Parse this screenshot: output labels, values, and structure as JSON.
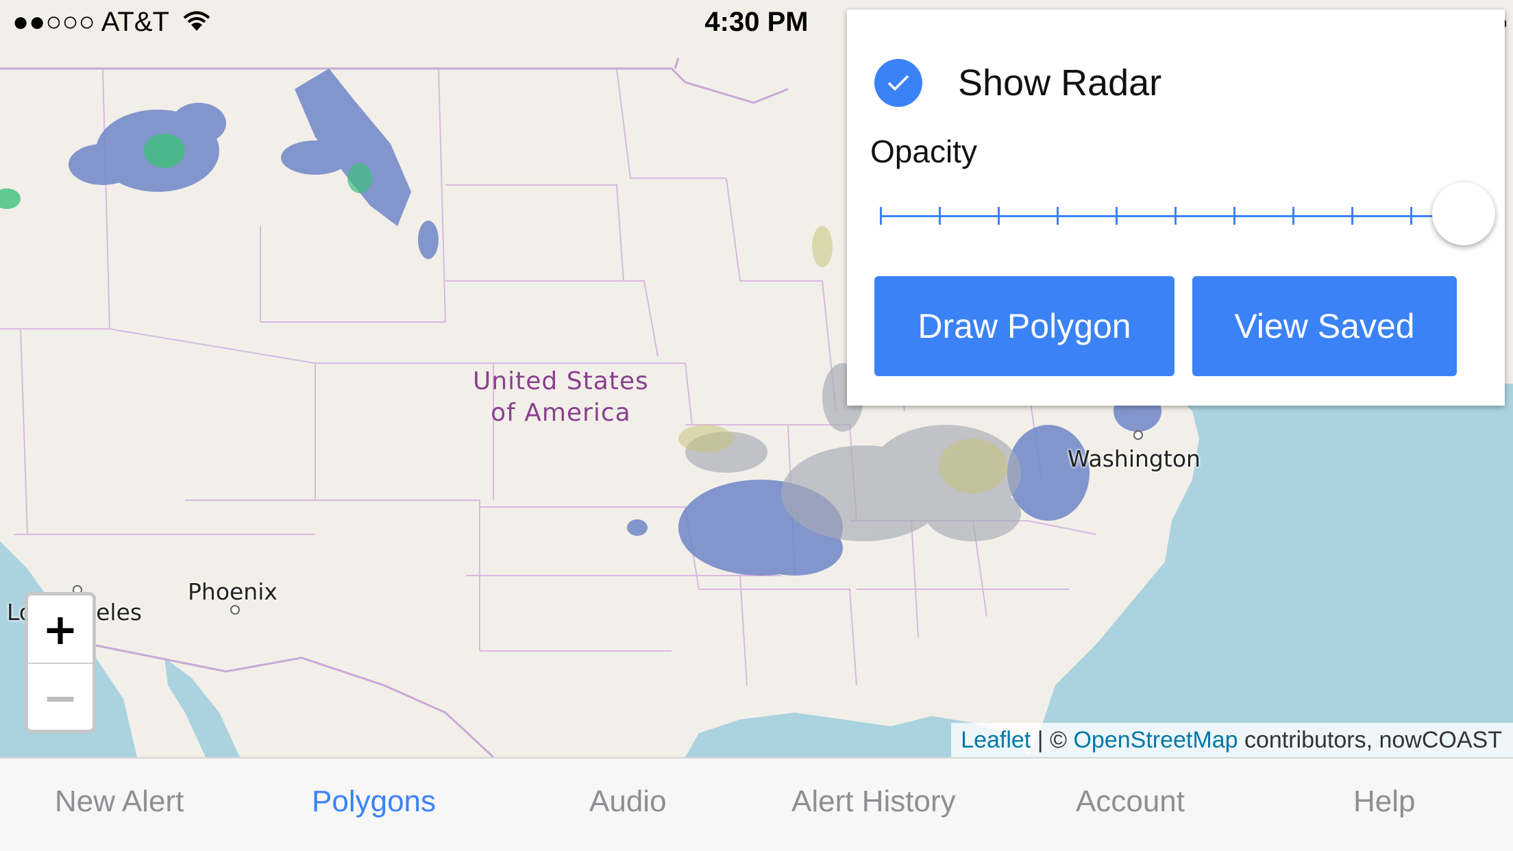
{
  "status_bar": {
    "carrier": "●●○○○ AT&T",
    "time": "4:30 PM"
  },
  "map": {
    "country_label_line1": "United States",
    "country_label_line2": "of America",
    "cities": {
      "washington": "Washington",
      "phoenix": "Phoenix",
      "los_angeles": "Los Angeles"
    },
    "zoom_in": "+",
    "zoom_out": "−",
    "attribution": {
      "leaflet": "Leaflet",
      "separator": " | © ",
      "osm": "OpenStreetMap",
      "rest": " contributors, nowCOAST"
    }
  },
  "radar_panel": {
    "show_radar_label": "Show Radar",
    "show_radar_checked": true,
    "opacity_label": "Opacity",
    "opacity_value": 1.0,
    "draw_polygon_label": "Draw Polygon",
    "view_saved_label": "View Saved"
  },
  "tabs": [
    {
      "label": "New Alert",
      "active": false
    },
    {
      "label": "Polygons",
      "active": true
    },
    {
      "label": "Audio",
      "active": false
    },
    {
      "label": "Alert History",
      "active": false
    },
    {
      "label": "Account",
      "active": false
    },
    {
      "label": "Help",
      "active": false
    }
  ],
  "colors": {
    "accent": "#3b82f6",
    "land": "#f2efe9",
    "water": "#aad3df",
    "border": "#c9a8d6",
    "radar_blue": "#5f78c0",
    "radar_green": "#3cc06a"
  }
}
